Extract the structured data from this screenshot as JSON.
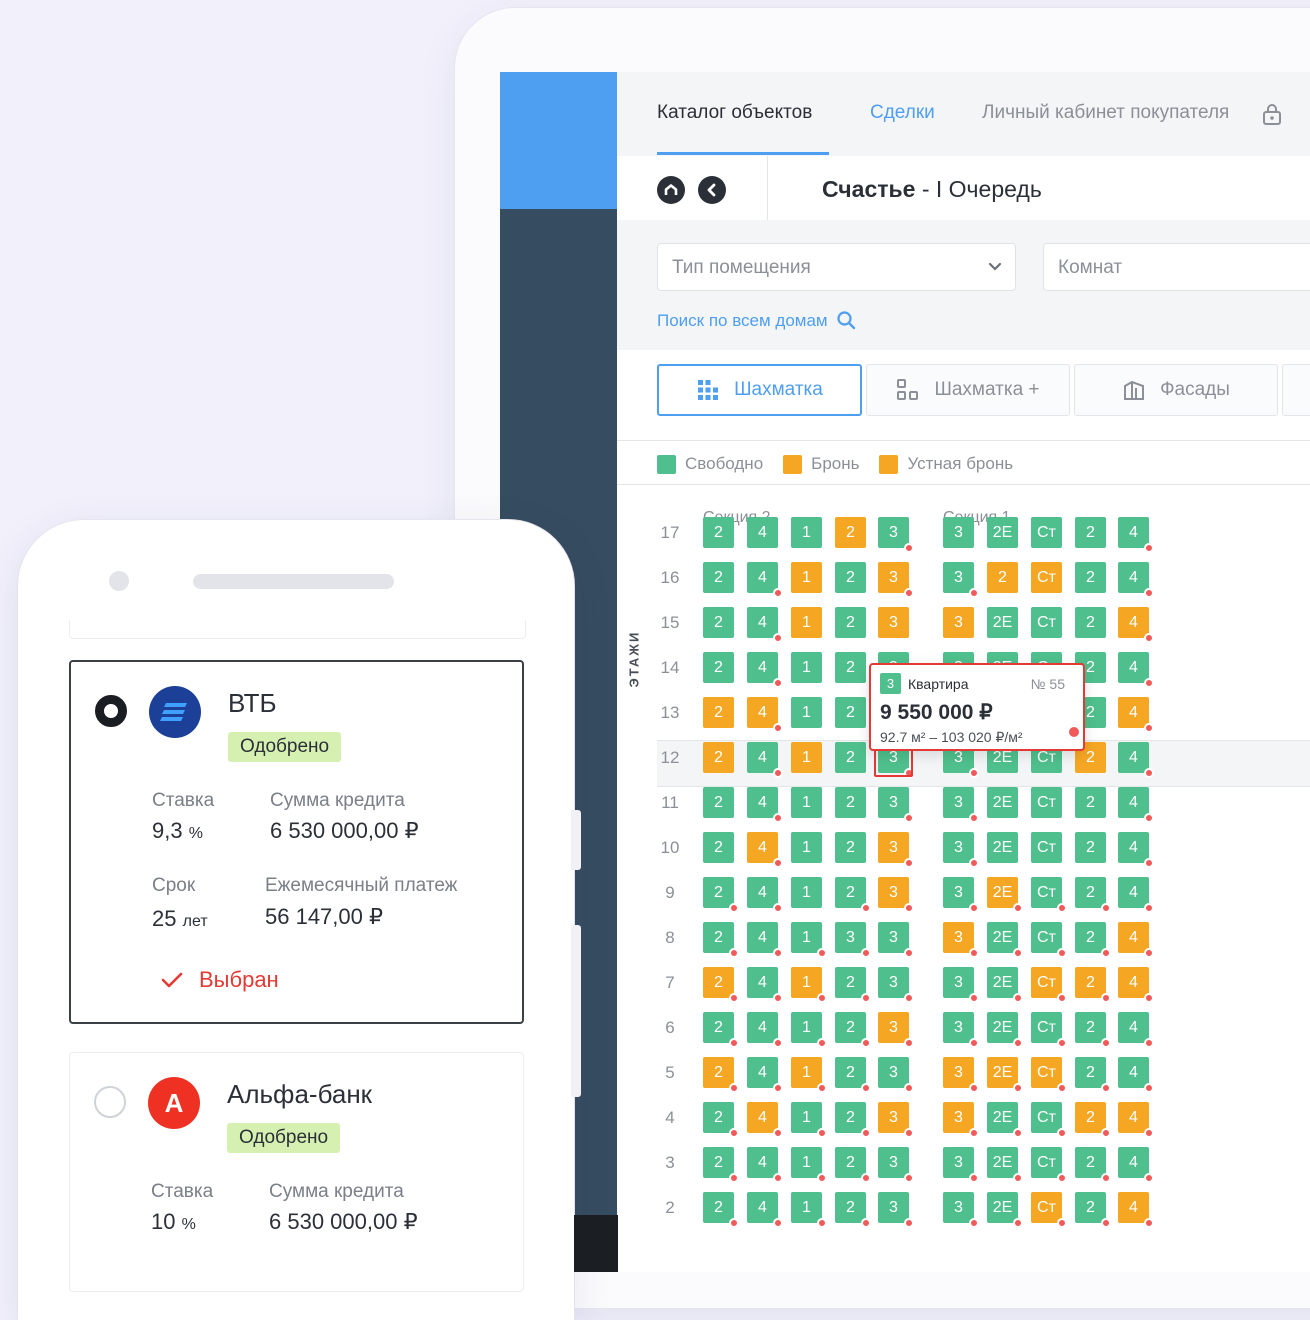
{
  "nav": {
    "tabs": [
      {
        "label": "Каталог объектов"
      },
      {
        "label": "Сделки"
      },
      {
        "label": "Личный кабинет покупателя"
      }
    ]
  },
  "header": {
    "title_bold": "Счастье",
    "title_rest": " - I Очередь"
  },
  "filters": {
    "type_placeholder": "Тип помещения",
    "rooms_placeholder": "Комнат",
    "search_all": "Поиск по всем домам"
  },
  "view_tabs": [
    {
      "label": "Шахматка",
      "icon": "grid-icon"
    },
    {
      "label": "Шахматка +",
      "icon": "grid-plus-icon"
    },
    {
      "label": "Фасады",
      "icon": "facade-icon"
    }
  ],
  "legend": [
    {
      "label": "Свободно",
      "color": "#4fc08d"
    },
    {
      "label": "Бронь",
      "color": "#f5a623"
    },
    {
      "label": "Устная бронь",
      "color": "#f5a623"
    }
  ],
  "colors": {
    "free": "#4fc08d",
    "booked": "#f5a623",
    "accent": "#4e9ef2",
    "alert": "#e53935"
  },
  "grid": {
    "axis_label": "ЭТАЖИ",
    "section_labels": [
      "Секция 2",
      "Секция 1"
    ],
    "columns": [
      "2",
      "4",
      "1",
      "2",
      "3",
      "3",
      "2Е",
      "Ст",
      "2",
      "4"
    ],
    "floors": [
      {
        "n": "17",
        "row": [
          [
            "2",
            "f",
            0
          ],
          [
            "4",
            "f",
            0
          ],
          [
            "1",
            "f",
            0
          ],
          [
            "2",
            "b",
            0
          ],
          [
            "3",
            "f",
            1
          ],
          [
            "3",
            "f",
            0
          ],
          [
            "2Е",
            "f",
            0
          ],
          [
            "Ст",
            "f",
            0
          ],
          [
            "2",
            "f",
            0
          ],
          [
            "4",
            "f",
            1
          ]
        ]
      },
      {
        "n": "16",
        "row": [
          [
            "2",
            "f",
            0
          ],
          [
            "4",
            "f",
            1
          ],
          [
            "1",
            "b",
            0
          ],
          [
            "2",
            "f",
            0
          ],
          [
            "3",
            "b",
            1
          ],
          [
            "3",
            "f",
            1
          ],
          [
            "2",
            "b",
            0
          ],
          [
            "Ст",
            "b",
            0
          ],
          [
            "2",
            "f",
            0
          ],
          [
            "4",
            "f",
            1
          ]
        ]
      },
      {
        "n": "15",
        "row": [
          [
            "2",
            "f",
            0
          ],
          [
            "4",
            "f",
            1
          ],
          [
            "1",
            "b",
            0
          ],
          [
            "2",
            "f",
            0
          ],
          [
            "3",
            "b",
            0
          ],
          [
            "3",
            "b",
            0
          ],
          [
            "2Е",
            "f",
            0
          ],
          [
            "Ст",
            "f",
            0
          ],
          [
            "2",
            "f",
            0
          ],
          [
            "4",
            "b",
            1
          ]
        ]
      },
      {
        "n": "14",
        "row": [
          [
            "2",
            "f",
            0
          ],
          [
            "4",
            "f",
            1
          ],
          [
            "1",
            "f",
            0
          ],
          [
            "2",
            "f",
            0
          ],
          [
            "3",
            "f",
            0
          ],
          [
            "3",
            "f",
            0
          ],
          [
            "2Е",
            "f",
            0
          ],
          [
            "Ст",
            "f",
            0
          ],
          [
            "2",
            "f",
            0
          ],
          [
            "4",
            "f",
            1
          ]
        ]
      },
      {
        "n": "13",
        "row": [
          [
            "2",
            "b",
            0
          ],
          [
            "4",
            "b",
            1
          ],
          [
            "1",
            "f",
            0
          ],
          [
            "2",
            "f",
            0
          ],
          [
            "3",
            "f",
            0
          ],
          [
            "3",
            "f",
            0
          ],
          [
            "2Е",
            "f",
            0
          ],
          [
            "Ст",
            "f",
            0
          ],
          [
            "2",
            "f",
            0
          ],
          [
            "4",
            "b",
            1
          ]
        ]
      },
      {
        "n": "12",
        "row": [
          [
            "2",
            "b",
            0
          ],
          [
            "4",
            "f",
            1
          ],
          [
            "1",
            "b",
            0
          ],
          [
            "2",
            "f",
            0
          ],
          [
            "3",
            "f",
            1
          ],
          [
            "3",
            "f",
            1
          ],
          [
            "2Е",
            "f",
            0
          ],
          [
            "Ст",
            "f",
            0
          ],
          [
            "2",
            "b",
            0
          ],
          [
            "4",
            "f",
            1
          ]
        ]
      },
      {
        "n": "11",
        "row": [
          [
            "2",
            "f",
            0
          ],
          [
            "4",
            "f",
            1
          ],
          [
            "1",
            "f",
            0
          ],
          [
            "2",
            "f",
            0
          ],
          [
            "3",
            "f",
            1
          ],
          [
            "3",
            "f",
            1
          ],
          [
            "2Е",
            "f",
            0
          ],
          [
            "Ст",
            "f",
            0
          ],
          [
            "2",
            "f",
            0
          ],
          [
            "4",
            "f",
            1
          ]
        ]
      },
      {
        "n": "10",
        "row": [
          [
            "2",
            "f",
            0
          ],
          [
            "4",
            "b",
            1
          ],
          [
            "1",
            "f",
            0
          ],
          [
            "2",
            "f",
            0
          ],
          [
            "3",
            "b",
            1
          ],
          [
            "3",
            "f",
            1
          ],
          [
            "2Е",
            "f",
            0
          ],
          [
            "Ст",
            "f",
            0
          ],
          [
            "2",
            "f",
            0
          ],
          [
            "4",
            "f",
            1
          ]
        ]
      },
      {
        "n": "9",
        "row": [
          [
            "2",
            "f",
            1
          ],
          [
            "4",
            "f",
            1
          ],
          [
            "1",
            "f",
            0
          ],
          [
            "2",
            "f",
            1
          ],
          [
            "3",
            "b",
            1
          ],
          [
            "3",
            "f",
            1
          ],
          [
            "2Е",
            "b",
            1
          ],
          [
            "Ст",
            "f",
            1
          ],
          [
            "2",
            "f",
            1
          ],
          [
            "4",
            "f",
            1
          ]
        ]
      },
      {
        "n": "8",
        "row": [
          [
            "2",
            "f",
            1
          ],
          [
            "4",
            "f",
            1
          ],
          [
            "1",
            "f",
            1
          ],
          [
            "3",
            "f",
            1
          ],
          [
            "3",
            "f",
            1
          ],
          [
            "3",
            "b",
            1
          ],
          [
            "2Е",
            "f",
            1
          ],
          [
            "Ст",
            "f",
            1
          ],
          [
            "2",
            "f",
            1
          ],
          [
            "4",
            "b",
            1
          ]
        ]
      },
      {
        "n": "7",
        "row": [
          [
            "2",
            "b",
            1
          ],
          [
            "4",
            "f",
            1
          ],
          [
            "1",
            "b",
            1
          ],
          [
            "2",
            "f",
            1
          ],
          [
            "3",
            "f",
            1
          ],
          [
            "3",
            "f",
            1
          ],
          [
            "2Е",
            "f",
            1
          ],
          [
            "Ст",
            "b",
            1
          ],
          [
            "2",
            "b",
            1
          ],
          [
            "4",
            "b",
            1
          ]
        ]
      },
      {
        "n": "6",
        "row": [
          [
            "2",
            "f",
            1
          ],
          [
            "4",
            "f",
            1
          ],
          [
            "1",
            "f",
            1
          ],
          [
            "2",
            "f",
            1
          ],
          [
            "3",
            "b",
            1
          ],
          [
            "3",
            "f",
            1
          ],
          [
            "2Е",
            "f",
            1
          ],
          [
            "Ст",
            "f",
            1
          ],
          [
            "2",
            "f",
            1
          ],
          [
            "4",
            "f",
            1
          ]
        ]
      },
      {
        "n": "5",
        "row": [
          [
            "2",
            "b",
            1
          ],
          [
            "4",
            "f",
            1
          ],
          [
            "1",
            "b",
            1
          ],
          [
            "2",
            "f",
            1
          ],
          [
            "3",
            "f",
            1
          ],
          [
            "3",
            "b",
            1
          ],
          [
            "2Е",
            "b",
            1
          ],
          [
            "Ст",
            "b",
            1
          ],
          [
            "2",
            "f",
            1
          ],
          [
            "4",
            "f",
            1
          ]
        ]
      },
      {
        "n": "4",
        "row": [
          [
            "2",
            "f",
            1
          ],
          [
            "4",
            "b",
            1
          ],
          [
            "1",
            "f",
            1
          ],
          [
            "2",
            "f",
            1
          ],
          [
            "3",
            "b",
            1
          ],
          [
            "3",
            "b",
            1
          ],
          [
            "2Е",
            "f",
            1
          ],
          [
            "Ст",
            "f",
            1
          ],
          [
            "2",
            "b",
            1
          ],
          [
            "4",
            "b",
            1
          ]
        ]
      },
      {
        "n": "3",
        "row": [
          [
            "2",
            "f",
            1
          ],
          [
            "4",
            "f",
            1
          ],
          [
            "1",
            "f",
            1
          ],
          [
            "2",
            "f",
            1
          ],
          [
            "3",
            "f",
            1
          ],
          [
            "3",
            "f",
            1
          ],
          [
            "2Е",
            "f",
            1
          ],
          [
            "Ст",
            "f",
            1
          ],
          [
            "2",
            "f",
            1
          ],
          [
            "4",
            "f",
            1
          ]
        ]
      },
      {
        "n": "2",
        "row": [
          [
            "2",
            "f",
            1
          ],
          [
            "4",
            "f",
            1
          ],
          [
            "1",
            "f",
            1
          ],
          [
            "2",
            "f",
            1
          ],
          [
            "3",
            "f",
            1
          ],
          [
            "3",
            "f",
            1
          ],
          [
            "2Е",
            "f",
            1
          ],
          [
            "Ст",
            "b",
            1
          ],
          [
            "2",
            "f",
            1
          ],
          [
            "4",
            "b",
            1
          ]
        ]
      }
    ]
  },
  "tooltip": {
    "rooms": "3",
    "type": "Квартира",
    "number": "№ 55",
    "price": "9 550 000 ₽",
    "area": "92.7 м² – 103 020 ₽/м²"
  },
  "phone": {
    "banks": [
      {
        "name": "ВТБ",
        "status": "Одобрено",
        "rate_label": "Ставка",
        "rate_value": "9,3",
        "rate_unit": "%",
        "sum_label": "Сумма кредита",
        "sum_value": "6 530 000,00 ₽",
        "term_label": "Срок",
        "term_value": "25",
        "term_unit": "лет",
        "payment_label": "Ежемесячный платеж",
        "payment_value": "56 147,00 ₽",
        "selected_label": "Выбран"
      },
      {
        "name": "Альфа-банк",
        "logo_letter": "А",
        "status": "Одобрено",
        "rate_label": "Ставка",
        "rate_value": "10",
        "rate_unit": "%",
        "sum_label": "Сумма кредита",
        "sum_value": "6 530 000,00 ₽"
      }
    ]
  }
}
